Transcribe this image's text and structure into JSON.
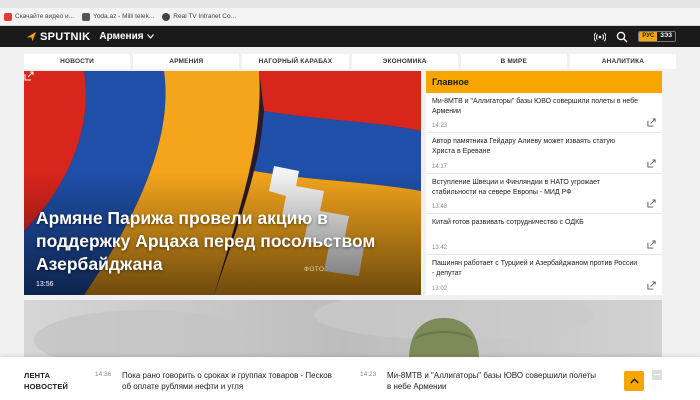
{
  "bookmarks": [
    {
      "label": "Скачайте видео и...",
      "color": "#e53935"
    },
    {
      "label": "Yoda.az - Milli telek...",
      "color": "#555555"
    },
    {
      "label": "Real TV Intranet Co...",
      "color": "#444444"
    }
  ],
  "header": {
    "logo": "SPUTNIK",
    "region": "Армения",
    "lang_active": "РУС",
    "lang_other": "ЗЭЗ",
    "icons": [
      "radio-icon",
      "search-icon"
    ]
  },
  "nav": [
    "НОВОСТИ",
    "АРМЕНИЯ",
    "НАГОРНЫЙ КАРАБАХ",
    "ЭКОНОМИКА",
    "В МИРЕ",
    "АНАЛИТИКА"
  ],
  "hero": {
    "title": "Армяне Парижа провели акцию в поддержку Арцаха перед посольством Азербайджана",
    "time": "13:56",
    "photo_credit": "ФОТО"
  },
  "sidebar": {
    "heading": "Главное",
    "items": [
      {
        "text": "Ми-8МТВ и \"Аллигаторы\" базы ЮВО совершили полеты в небе Армении",
        "time": "14:23"
      },
      {
        "text": "Автор памятника Гейдару Алиеву может изваять статую Христа в Ереване",
        "time": "14:17"
      },
      {
        "text": "Вступление Швеции и Финляндии в НАТО угрожает стабильности на севере Европы - МИД РФ",
        "time": "13:48"
      },
      {
        "text": "Китай готов развивать сотрудничество с ОДКБ",
        "time": "13:42"
      },
      {
        "text": "Пашинян работает с Турцией и Азербайджаном против России - депутат",
        "time": "13:02"
      }
    ]
  },
  "ticker": {
    "label_line1": "ЛЕНТА",
    "label_line2": "НОВОСТЕЙ",
    "items": [
      {
        "time": "14:36",
        "text": "Пока рано говорить о сроках и группах товаров - Песков об оплате рублями нефти и угля"
      },
      {
        "time": "14:23",
        "text": "Ми-8МТВ и \"Аллигаторы\" базы ЮВО совершили полеты в небе Армении"
      }
    ]
  },
  "colors": {
    "accent": "#f7a600",
    "header_bg": "#1a1a1a"
  }
}
